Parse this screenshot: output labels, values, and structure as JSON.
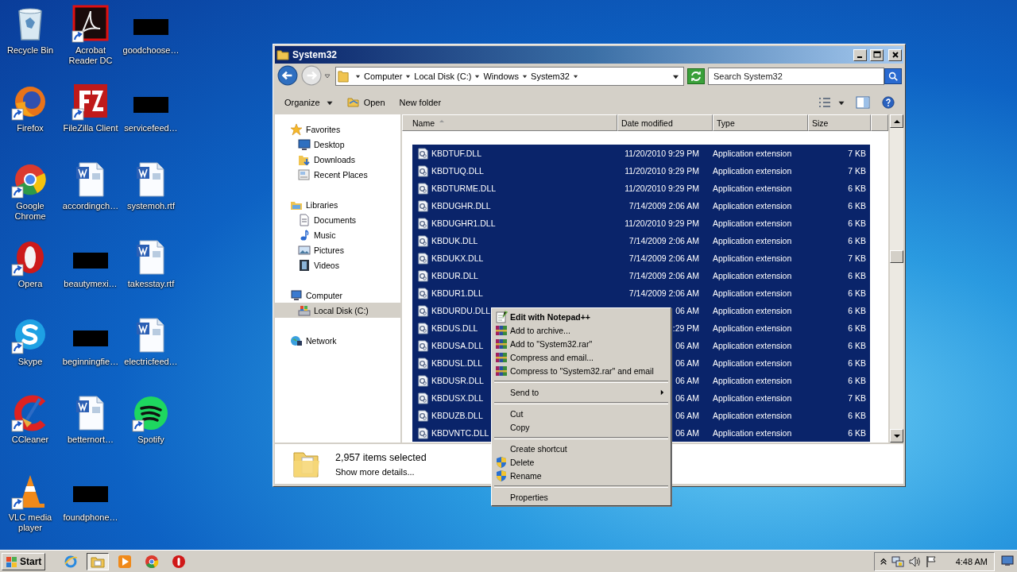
{
  "desktop": {
    "icons": [
      {
        "label": "Recycle Bin",
        "kind": "recycle",
        "shortcut": false
      },
      {
        "label": "Firefox",
        "kind": "firefox",
        "shortcut": true
      },
      {
        "label": "Google Chrome",
        "kind": "chrome",
        "shortcut": true
      },
      {
        "label": "Opera",
        "kind": "opera",
        "shortcut": true
      },
      {
        "label": "Skype",
        "kind": "skype",
        "shortcut": true
      },
      {
        "label": "CCleaner",
        "kind": "ccleaner",
        "shortcut": true
      },
      {
        "label": "VLC media player",
        "kind": "vlc",
        "shortcut": true
      },
      {
        "label": "Acrobat Reader DC",
        "kind": "acrobat",
        "shortcut": true
      },
      {
        "label": "FileZilla Client",
        "kind": "filezilla",
        "shortcut": true
      },
      {
        "label": "accordingch…",
        "kind": "word",
        "shortcut": false
      },
      {
        "label": "beautymexi…",
        "kind": "redacted",
        "shortcut": false
      },
      {
        "label": "beginningfie…",
        "kind": "redacted",
        "shortcut": false
      },
      {
        "label": "betternort…",
        "kind": "word",
        "shortcut": false
      },
      {
        "label": "foundphone…",
        "kind": "redacted",
        "shortcut": false
      },
      {
        "label": "goodchoose…",
        "kind": "redacted",
        "shortcut": false
      },
      {
        "label": "servicefeed…",
        "kind": "redacted",
        "shortcut": false
      },
      {
        "label": "systemoh.rtf",
        "kind": "word",
        "shortcut": false
      },
      {
        "label": "takesstay.rtf",
        "kind": "word",
        "shortcut": false
      },
      {
        "label": "electricfeed…",
        "kind": "word",
        "shortcut": false
      },
      {
        "label": "Spotify",
        "kind": "spotify",
        "shortcut": true
      }
    ]
  },
  "window": {
    "title": "System32",
    "breadcrumb": [
      "Computer",
      "Local Disk (C:)",
      "Windows",
      "System32"
    ],
    "search": {
      "placeholder": "Search System32"
    },
    "toolbar": [
      {
        "label": "Organize",
        "kind": "menu"
      },
      {
        "label": "Open",
        "kind": "open"
      },
      {
        "label": "New folder",
        "kind": "plain"
      }
    ],
    "nav": [
      {
        "label": "Favorites",
        "kind": "star",
        "selected": false,
        "children": [
          {
            "label": "Desktop",
            "kind": "desktop",
            "selected": false
          },
          {
            "label": "Downloads",
            "kind": "downloads",
            "selected": false
          },
          {
            "label": "Recent Places",
            "kind": "recent",
            "selected": false
          }
        ]
      },
      {
        "label": "Libraries",
        "kind": "libraries",
        "selected": false,
        "children": [
          {
            "label": "Documents",
            "kind": "documents",
            "selected": false
          },
          {
            "label": "Music",
            "kind": "music",
            "selected": false
          },
          {
            "label": "Pictures",
            "kind": "pictures",
            "selected": false
          },
          {
            "label": "Videos",
            "kind": "videos",
            "selected": false
          }
        ]
      },
      {
        "label": "Computer",
        "kind": "computer",
        "selected": false,
        "children": [
          {
            "label": "Local Disk (C:)",
            "kind": "disk",
            "selected": true
          }
        ]
      },
      {
        "label": "Network",
        "kind": "network",
        "selected": false
      }
    ],
    "columns": [
      {
        "label": "Name",
        "sorted": true
      },
      {
        "label": "Date modified",
        "sorted": false
      },
      {
        "label": "Type",
        "sorted": false
      },
      {
        "label": "Size",
        "sorted": false
      }
    ],
    "rows": [
      {
        "name": "KBDTUF.DLL",
        "date": "11/20/2010 9:29 PM",
        "type": "Application extension",
        "size": "7 KB",
        "selected": true
      },
      {
        "name": "KBDTUQ.DLL",
        "date": "11/20/2010 9:29 PM",
        "type": "Application extension",
        "size": "7 KB",
        "selected": true
      },
      {
        "name": "KBDTURME.DLL",
        "date": "11/20/2010 9:29 PM",
        "type": "Application extension",
        "size": "6 KB",
        "selected": true
      },
      {
        "name": "KBDUGHR.DLL",
        "date": "7/14/2009 2:06 AM",
        "type": "Application extension",
        "size": "6 KB",
        "selected": true
      },
      {
        "name": "KBDUGHR1.DLL",
        "date": "11/20/2010 9:29 PM",
        "type": "Application extension",
        "size": "6 KB",
        "selected": true
      },
      {
        "name": "KBDUK.DLL",
        "date": "7/14/2009 2:06 AM",
        "type": "Application extension",
        "size": "6 KB",
        "selected": true
      },
      {
        "name": "KBDUKX.DLL",
        "date": "7/14/2009 2:06 AM",
        "type": "Application extension",
        "size": "7 KB",
        "selected": true
      },
      {
        "name": "KBDUR.DLL",
        "date": "7/14/2009 2:06 AM",
        "type": "Application extension",
        "size": "6 KB",
        "selected": true
      },
      {
        "name": "KBDUR1.DLL",
        "date": "7/14/2009 2:06 AM",
        "type": "Application extension",
        "size": "6 KB",
        "selected": true
      },
      {
        "name": "KBDURDU.DLL",
        "date": "06 AM",
        "type": "Application extension",
        "size": "6 KB",
        "selected": true
      },
      {
        "name": "KBDUS.DLL",
        "date": ":29 PM",
        "type": "Application extension",
        "size": "6 KB",
        "selected": true
      },
      {
        "name": "KBDUSA.DLL",
        "date": "06 AM",
        "type": "Application extension",
        "size": "6 KB",
        "selected": true
      },
      {
        "name": "KBDUSL.DLL",
        "date": "06 AM",
        "type": "Application extension",
        "size": "6 KB",
        "selected": true
      },
      {
        "name": "KBDUSR.DLL",
        "date": "06 AM",
        "type": "Application extension",
        "size": "6 KB",
        "selected": true
      },
      {
        "name": "KBDUSX.DLL",
        "date": "06 AM",
        "type": "Application extension",
        "size": "7 KB",
        "selected": true
      },
      {
        "name": "KBDUZB.DLL",
        "date": "06 AM",
        "type": "Application extension",
        "size": "6 KB",
        "selected": true
      },
      {
        "name": "KBDVNTC.DLL",
        "date": "06 AM",
        "type": "Application extension",
        "size": "6 KB",
        "selected": true
      }
    ],
    "details": {
      "count": "2,957 items selected",
      "more": "Show more details..."
    }
  },
  "context_menu": {
    "groups": [
      [
        {
          "label": "Edit with Notepad++",
          "kind": "notepad",
          "bold": true,
          "submenu": false
        },
        {
          "label": "Add to archive...",
          "kind": "archive",
          "bold": false,
          "submenu": false
        },
        {
          "label": "Add to \"System32.rar\"",
          "kind": "archive",
          "bold": false,
          "submenu": false
        },
        {
          "label": "Compress and email...",
          "kind": "archive",
          "bold": false,
          "submenu": false
        },
        {
          "label": "Compress to \"System32.rar\" and email",
          "kind": "archive",
          "bold": false,
          "submenu": false
        }
      ],
      [
        {
          "label": "Send to",
          "kind": "plain",
          "bold": false,
          "submenu": true
        }
      ],
      [
        {
          "label": "Cut",
          "kind": "plain",
          "bold": false,
          "submenu": false
        },
        {
          "label": "Copy",
          "kind": "plain",
          "bold": false,
          "submenu": false
        }
      ],
      [
        {
          "label": "Create shortcut",
          "kind": "plain",
          "bold": false,
          "submenu": false
        },
        {
          "label": "Delete",
          "kind": "shield",
          "bold": false,
          "submenu": false
        },
        {
          "label": "Rename",
          "kind": "shield",
          "bold": false,
          "submenu": false
        }
      ],
      [
        {
          "label": "Properties",
          "kind": "plain",
          "bold": false,
          "submenu": false
        }
      ]
    ]
  },
  "taskbar": {
    "start": "Start",
    "apps": [
      {
        "kind": "ie",
        "active": false
      },
      {
        "kind": "explorer",
        "active": true
      },
      {
        "kind": "media",
        "active": false
      },
      {
        "kind": "chrome",
        "active": false
      },
      {
        "kind": "red",
        "active": false
      }
    ],
    "clock": "4:48 AM"
  }
}
